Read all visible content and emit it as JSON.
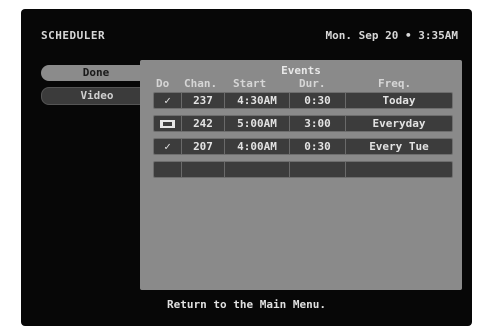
{
  "header": {
    "title": "SCHEDULER",
    "datetime": "Mon. Sep 20 • 3:35AM"
  },
  "sidebar": {
    "items": [
      {
        "label": "Done"
      },
      {
        "label": "Video"
      }
    ]
  },
  "panel": {
    "title": "Events",
    "columns": [
      "Do",
      "Chan.",
      "Start",
      "Dur.",
      "Freq."
    ],
    "rows": [
      {
        "do": "✓",
        "do_icon": "",
        "chan": "237",
        "start": "4:30AM",
        "dur": "0:30",
        "freq": "Today"
      },
      {
        "do": "",
        "do_icon": "record-icon",
        "chan": "242",
        "start": "5:00AM",
        "dur": "3:00",
        "freq": "Everyday"
      },
      {
        "do": "✓",
        "do_icon": "",
        "chan": "207",
        "start": "4:00AM",
        "dur": "0:30",
        "freq": "Every Tue"
      },
      {
        "do": "",
        "do_icon": "",
        "chan": "",
        "start": "",
        "dur": "",
        "freq": ""
      }
    ]
  },
  "footer": {
    "help_text": "Return to the Main Menu."
  }
}
